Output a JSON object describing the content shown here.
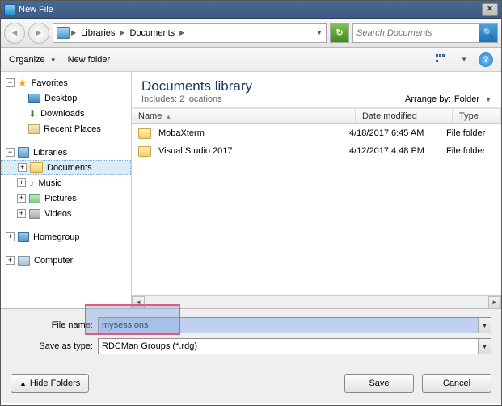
{
  "title": "New File",
  "breadcrumb": {
    "root": "Libraries",
    "current": "Documents"
  },
  "search": {
    "placeholder": "Search Documents"
  },
  "toolbar": {
    "organize": "Organize",
    "newfolder": "New folder"
  },
  "tree": {
    "favorites": "Favorites",
    "desktop": "Desktop",
    "downloads": "Downloads",
    "recent": "Recent Places",
    "libraries": "Libraries",
    "documents": "Documents",
    "music": "Music",
    "pictures": "Pictures",
    "videos": "Videos",
    "homegroup": "Homegroup",
    "computer": "Computer"
  },
  "library": {
    "title": "Documents library",
    "subtitle": "Includes: 2 locations",
    "arrange_label": "Arrange by:",
    "arrange_value": "Folder"
  },
  "columns": {
    "name": "Name",
    "date": "Date modified",
    "type": "Type"
  },
  "rows": [
    {
      "name": "MobaXterm",
      "date": "4/18/2017 6:45 AM",
      "type": "File folder"
    },
    {
      "name": "Visual Studio 2017",
      "date": "4/12/2017 4:48 PM",
      "type": "File folder"
    }
  ],
  "form": {
    "filename_label": "File name:",
    "filename_value": "mysessions",
    "savetype_label": "Save as type:",
    "savetype_value": "RDCMan Groups (*.rdg)"
  },
  "buttons": {
    "hide": "Hide Folders",
    "save": "Save",
    "cancel": "Cancel"
  }
}
